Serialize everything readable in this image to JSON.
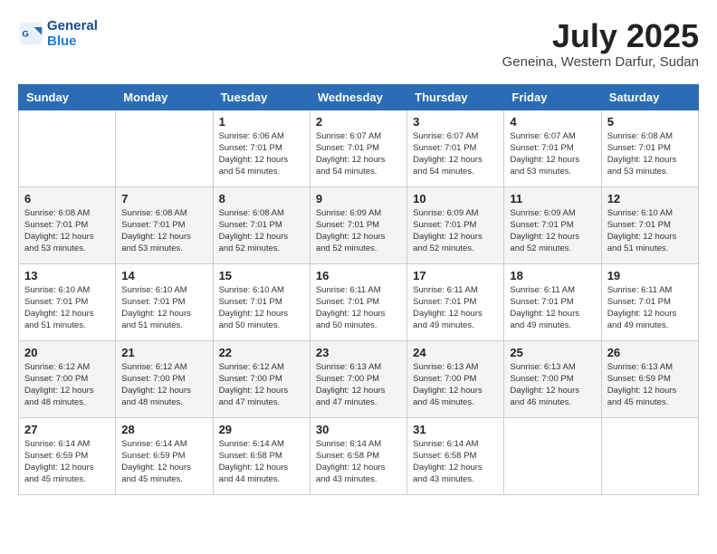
{
  "header": {
    "logo_line1": "General",
    "logo_line2": "Blue",
    "month_year": "July 2025",
    "location": "Geneina, Western Darfur, Sudan"
  },
  "days_of_week": [
    "Sunday",
    "Monday",
    "Tuesday",
    "Wednesday",
    "Thursday",
    "Friday",
    "Saturday"
  ],
  "weeks": [
    [
      {
        "day": "",
        "info": ""
      },
      {
        "day": "",
        "info": ""
      },
      {
        "day": "1",
        "info": "Sunrise: 6:06 AM\nSunset: 7:01 PM\nDaylight: 12 hours\nand 54 minutes."
      },
      {
        "day": "2",
        "info": "Sunrise: 6:07 AM\nSunset: 7:01 PM\nDaylight: 12 hours\nand 54 minutes."
      },
      {
        "day": "3",
        "info": "Sunrise: 6:07 AM\nSunset: 7:01 PM\nDaylight: 12 hours\nand 54 minutes."
      },
      {
        "day": "4",
        "info": "Sunrise: 6:07 AM\nSunset: 7:01 PM\nDaylight: 12 hours\nand 53 minutes."
      },
      {
        "day": "5",
        "info": "Sunrise: 6:08 AM\nSunset: 7:01 PM\nDaylight: 12 hours\nand 53 minutes."
      }
    ],
    [
      {
        "day": "6",
        "info": "Sunrise: 6:08 AM\nSunset: 7:01 PM\nDaylight: 12 hours\nand 53 minutes."
      },
      {
        "day": "7",
        "info": "Sunrise: 6:08 AM\nSunset: 7:01 PM\nDaylight: 12 hours\nand 53 minutes."
      },
      {
        "day": "8",
        "info": "Sunrise: 6:08 AM\nSunset: 7:01 PM\nDaylight: 12 hours\nand 52 minutes."
      },
      {
        "day": "9",
        "info": "Sunrise: 6:09 AM\nSunset: 7:01 PM\nDaylight: 12 hours\nand 52 minutes."
      },
      {
        "day": "10",
        "info": "Sunrise: 6:09 AM\nSunset: 7:01 PM\nDaylight: 12 hours\nand 52 minutes."
      },
      {
        "day": "11",
        "info": "Sunrise: 6:09 AM\nSunset: 7:01 PM\nDaylight: 12 hours\nand 52 minutes."
      },
      {
        "day": "12",
        "info": "Sunrise: 6:10 AM\nSunset: 7:01 PM\nDaylight: 12 hours\nand 51 minutes."
      }
    ],
    [
      {
        "day": "13",
        "info": "Sunrise: 6:10 AM\nSunset: 7:01 PM\nDaylight: 12 hours\nand 51 minutes."
      },
      {
        "day": "14",
        "info": "Sunrise: 6:10 AM\nSunset: 7:01 PM\nDaylight: 12 hours\nand 51 minutes."
      },
      {
        "day": "15",
        "info": "Sunrise: 6:10 AM\nSunset: 7:01 PM\nDaylight: 12 hours\nand 50 minutes."
      },
      {
        "day": "16",
        "info": "Sunrise: 6:11 AM\nSunset: 7:01 PM\nDaylight: 12 hours\nand 50 minutes."
      },
      {
        "day": "17",
        "info": "Sunrise: 6:11 AM\nSunset: 7:01 PM\nDaylight: 12 hours\nand 49 minutes."
      },
      {
        "day": "18",
        "info": "Sunrise: 6:11 AM\nSunset: 7:01 PM\nDaylight: 12 hours\nand 49 minutes."
      },
      {
        "day": "19",
        "info": "Sunrise: 6:11 AM\nSunset: 7:01 PM\nDaylight: 12 hours\nand 49 minutes."
      }
    ],
    [
      {
        "day": "20",
        "info": "Sunrise: 6:12 AM\nSunset: 7:00 PM\nDaylight: 12 hours\nand 48 minutes."
      },
      {
        "day": "21",
        "info": "Sunrise: 6:12 AM\nSunset: 7:00 PM\nDaylight: 12 hours\nand 48 minutes."
      },
      {
        "day": "22",
        "info": "Sunrise: 6:12 AM\nSunset: 7:00 PM\nDaylight: 12 hours\nand 47 minutes."
      },
      {
        "day": "23",
        "info": "Sunrise: 6:13 AM\nSunset: 7:00 PM\nDaylight: 12 hours\nand 47 minutes."
      },
      {
        "day": "24",
        "info": "Sunrise: 6:13 AM\nSunset: 7:00 PM\nDaylight: 12 hours\nand 46 minutes."
      },
      {
        "day": "25",
        "info": "Sunrise: 6:13 AM\nSunset: 7:00 PM\nDaylight: 12 hours\nand 46 minutes."
      },
      {
        "day": "26",
        "info": "Sunrise: 6:13 AM\nSunset: 6:59 PM\nDaylight: 12 hours\nand 45 minutes."
      }
    ],
    [
      {
        "day": "27",
        "info": "Sunrise: 6:14 AM\nSunset: 6:59 PM\nDaylight: 12 hours\nand 45 minutes."
      },
      {
        "day": "28",
        "info": "Sunrise: 6:14 AM\nSunset: 6:59 PM\nDaylight: 12 hours\nand 45 minutes."
      },
      {
        "day": "29",
        "info": "Sunrise: 6:14 AM\nSunset: 6:58 PM\nDaylight: 12 hours\nand 44 minutes."
      },
      {
        "day": "30",
        "info": "Sunrise: 6:14 AM\nSunset: 6:58 PM\nDaylight: 12 hours\nand 43 minutes."
      },
      {
        "day": "31",
        "info": "Sunrise: 6:14 AM\nSunset: 6:58 PM\nDaylight: 12 hours\nand 43 minutes."
      },
      {
        "day": "",
        "info": ""
      },
      {
        "day": "",
        "info": ""
      }
    ]
  ]
}
